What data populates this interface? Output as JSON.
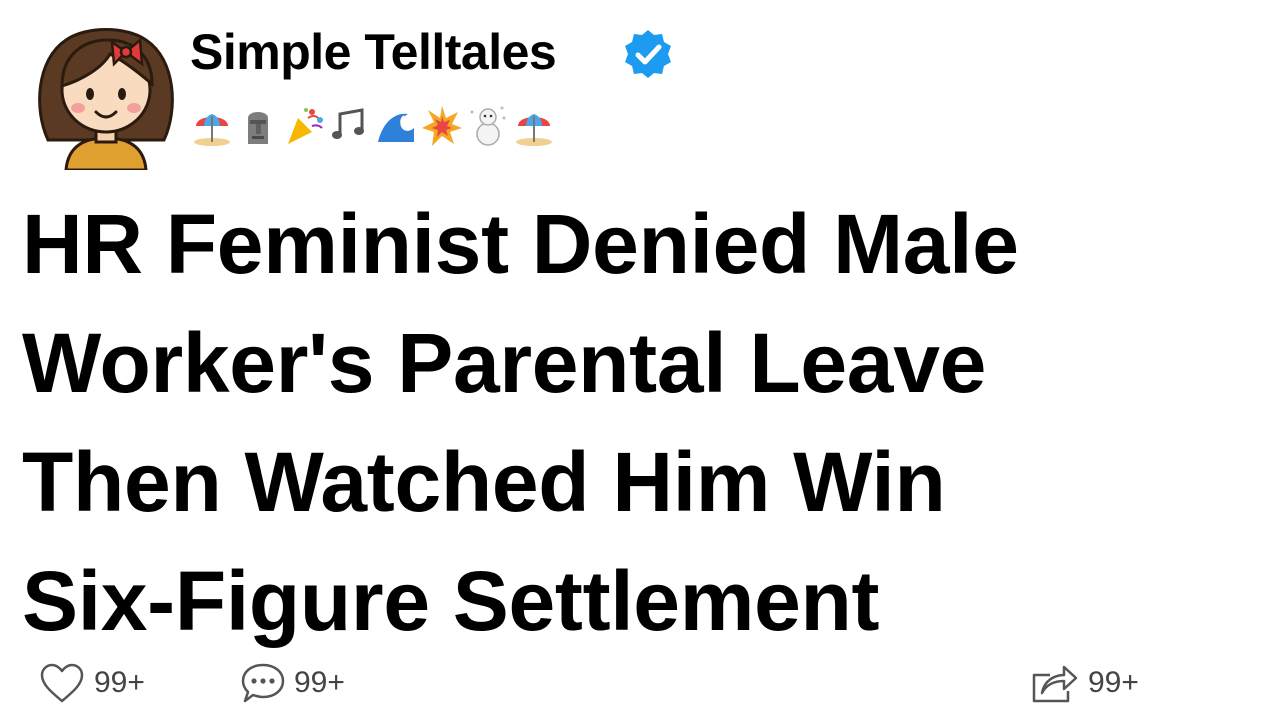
{
  "author": {
    "name": "Simple Telltales",
    "verified": true,
    "avatar_icon": "cartoon-girl-avatar-icon",
    "accent_color": "#1d9bf0"
  },
  "status_emojis": [
    "beach-umbrella-icon",
    "moai-icon",
    "party-popper-icon",
    "music-notes-icon",
    "wave-icon",
    "collision-icon",
    "snowman-icon",
    "beach-umbrella-icon"
  ],
  "headline": {
    "lines": [
      "HR Feminist Denied Male",
      "Worker's Parental Leave",
      "Then Watched Him Win",
      "Six-Figure Settlement"
    ]
  },
  "actions": {
    "like": {
      "icon": "heart-icon",
      "count": "99+"
    },
    "comment": {
      "icon": "comment-bubble-icon",
      "count": "99+"
    },
    "share": {
      "icon": "share-icon",
      "count": "99+"
    }
  }
}
